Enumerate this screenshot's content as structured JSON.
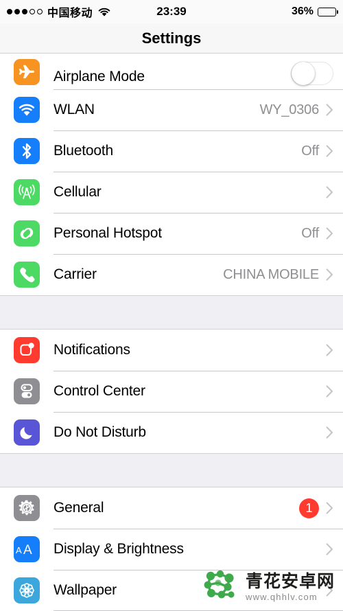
{
  "status_bar": {
    "signal_dots_filled": 3,
    "signal_dots_total": 5,
    "carrier": "中国移动",
    "wifi_icon": "wifi-icon",
    "time": "23:39",
    "battery_percent": "36%",
    "battery_level": 36
  },
  "nav": {
    "title": "Settings"
  },
  "groups": [
    {
      "id": "connectivity",
      "rows": [
        {
          "id": "airplane-mode",
          "label": "Airplane Mode",
          "icon": "airplane-icon",
          "icon_color": "#f79421",
          "accessory": "toggle",
          "toggle_on": false,
          "clipped": true
        },
        {
          "id": "wlan",
          "label": "WLAN",
          "icon": "wifi-icon",
          "icon_color": "#147efb",
          "accessory": "chevron",
          "value": "WY_0306"
        },
        {
          "id": "bluetooth",
          "label": "Bluetooth",
          "icon": "bluetooth-icon",
          "icon_color": "#147efb",
          "accessory": "chevron",
          "value": "Off"
        },
        {
          "id": "cellular",
          "label": "Cellular",
          "icon": "cellular-antenna-icon",
          "icon_color": "#4cd964",
          "accessory": "chevron",
          "value": ""
        },
        {
          "id": "personal-hotspot",
          "label": "Personal Hotspot",
          "icon": "hotspot-link-icon",
          "icon_color": "#4cd964",
          "accessory": "chevron",
          "value": "Off"
        },
        {
          "id": "carrier",
          "label": "Carrier",
          "icon": "phone-icon",
          "icon_color": "#4cd964",
          "accessory": "chevron",
          "value": "CHINA MOBILE"
        }
      ]
    },
    {
      "id": "alerts",
      "rows": [
        {
          "id": "notifications",
          "label": "Notifications",
          "icon": "notifications-icon",
          "icon_color": "#ff3b30",
          "accessory": "chevron",
          "value": ""
        },
        {
          "id": "control-center",
          "label": "Control Center",
          "icon": "control-center-icon",
          "icon_color": "#8e8e93",
          "accessory": "chevron",
          "value": ""
        },
        {
          "id": "do-not-disturb",
          "label": "Do Not Disturb",
          "icon": "moon-icon",
          "icon_color": "#5856d6",
          "accessory": "chevron",
          "value": ""
        }
      ]
    },
    {
      "id": "system",
      "rows": [
        {
          "id": "general",
          "label": "General",
          "icon": "gear-icon",
          "icon_color": "#8e8e93",
          "accessory": "chevron",
          "badge": "1"
        },
        {
          "id": "display-brightness",
          "label": "Display & Brightness",
          "icon": "aa-text-icon",
          "icon_color": "#147efb",
          "accessory": "chevron",
          "value": ""
        },
        {
          "id": "wallpaper",
          "label": "Wallpaper",
          "icon": "wallpaper-flower-icon",
          "icon_color": "#3ba7dd",
          "accessory": "chevron",
          "value": ""
        }
      ]
    }
  ],
  "watermark": {
    "logo_icon": "qinghua-logo-icon",
    "site_name": "青花安卓网",
    "site_url": "www.qhhlv.com",
    "color": "#3faa4b"
  },
  "colors": {
    "group_background": "#efeff4",
    "separator": "#c8c7cc",
    "value_text": "#8e8e93",
    "badge": "#ff3b30"
  }
}
